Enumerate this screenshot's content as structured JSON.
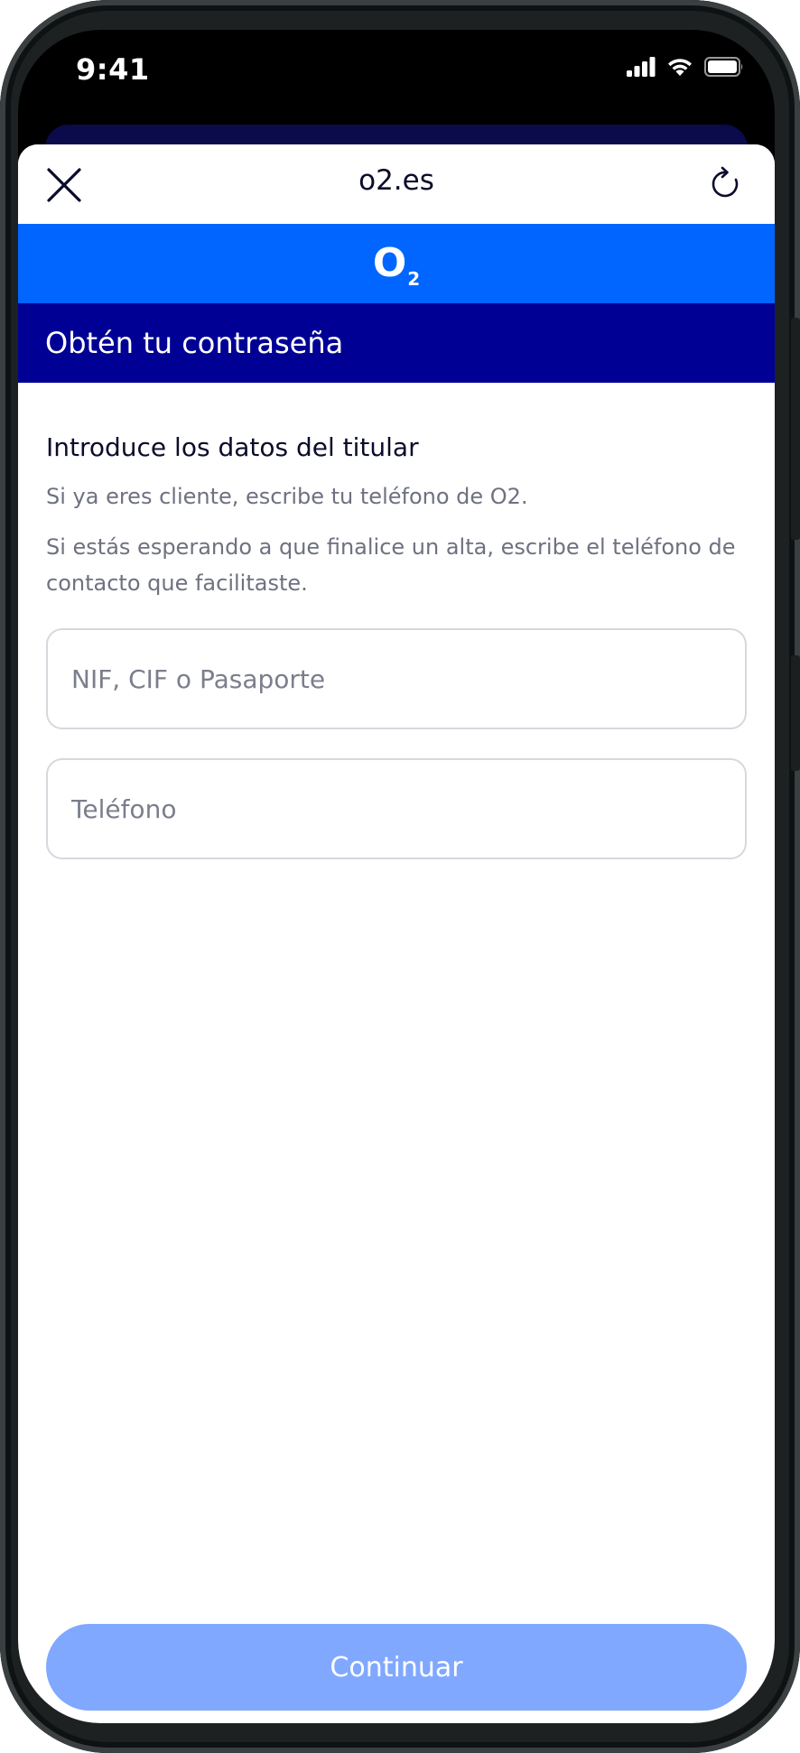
{
  "status_bar": {
    "time": "9:41",
    "icons": [
      "signal-icon",
      "wifi-icon",
      "battery-icon"
    ]
  },
  "browser": {
    "close_icon": "close-icon",
    "url": "o2.es",
    "reload_icon": "reload-icon"
  },
  "brand": {
    "logo_main": "O",
    "logo_sub": "2",
    "color": "#0066ff"
  },
  "header": {
    "title": "Obtén tu contraseña",
    "color": "#000094"
  },
  "form": {
    "heading": "Introduce los datos del titular",
    "description_1": "Si ya eres cliente, escribe tu teléfono de O2.",
    "description_2": "Si estás esperando a que finalice un alta, escribe el teléfono de contacto que facilitaste.",
    "id_field": {
      "placeholder": "NIF, CIF o Pasaporte",
      "value": ""
    },
    "phone_field": {
      "placeholder": "Teléfono",
      "value": ""
    }
  },
  "actions": {
    "continue_label": "Continuar",
    "continue_color": "#80a8ff"
  }
}
